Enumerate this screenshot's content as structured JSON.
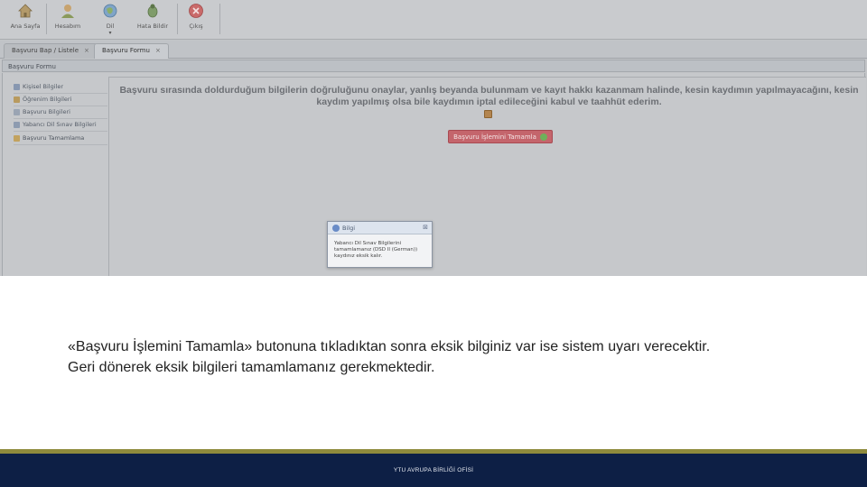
{
  "toolbar": {
    "buttons": [
      {
        "label": "Ana Sayfa",
        "icon": "home-icon"
      },
      {
        "label": "Hesabım",
        "icon": "user-icon"
      },
      {
        "label": "Dil",
        "icon": "globe-icon"
      },
      {
        "label": "Hata Bildir",
        "icon": "bug-icon"
      },
      {
        "label": "Çıkış",
        "icon": "close-circle-icon"
      }
    ]
  },
  "tabs": [
    {
      "label": "Başvuru Bap / Listele"
    },
    {
      "label": "Başvuru Formu"
    }
  ],
  "panel_title": "Başvuru Formu",
  "sidebar": {
    "items": [
      {
        "label": "Kişisel Bilgiler"
      },
      {
        "label": "Öğrenim Bilgileri"
      },
      {
        "label": "Başvuru Bilgileri"
      },
      {
        "label": "Yabancı Dil Sınav Bilgileri"
      },
      {
        "label": "Başvuru Tamamlama"
      }
    ]
  },
  "main": {
    "pledge_text": "Başvuru sırasında doldurduğum bilgilerin doğruluğunu onaylar, yanlış beyanda bulunmam ve kayıt hakkı kazanmam halinde, kesin kaydımın yapılmayacağını, kesin kaydım yapılmış olsa bile kaydımın iptal edileceğini kabul ve taahhüt ederim.",
    "complete_button_label": "Başvuru İşlemini Tamamla"
  },
  "dialog": {
    "title": "Bilgi",
    "message": "Yabancı Dil Sınav Bilgilerini tamamlamanız (DSD II (German)) kaydınız eksik kalır."
  },
  "caption": {
    "line1": "«Başvuru İşlemini Tamamla» butonuna tıkladıktan sonra eksik bilginiz var ise sistem uyarı verecektir.",
    "line2": "Geri dönerek eksik bilgileri tamamlamanız gerekmektedir."
  },
  "footer": {
    "text": "YTU AVRUPA BİRLİĞİ OFİSİ"
  },
  "colors": {
    "footer_bg": "#0d1f45",
    "footer_stripe": "#8e8a3c",
    "complete_button": "#c4656c"
  }
}
